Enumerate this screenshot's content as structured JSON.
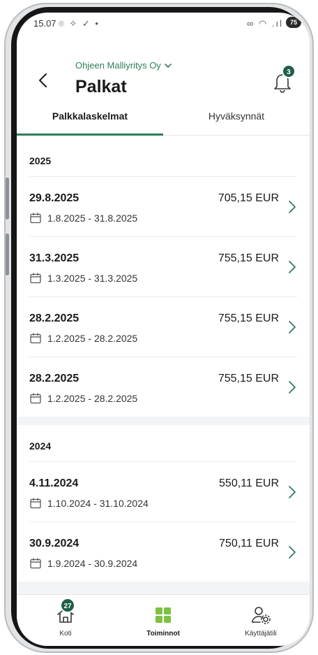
{
  "status_bar": {
    "time": "15.07",
    "icons_left": "⌾ ✧ ✓ •",
    "icons_right": "∞ ◠ .ıl",
    "battery": "75"
  },
  "header": {
    "company": "Ohjeen Malliyritys Oy",
    "title": "Palkat",
    "notification_count": "3"
  },
  "tabs": [
    {
      "label": "Palkkalaskelmat",
      "active": true
    },
    {
      "label": "Hyväksynnät",
      "active": false
    }
  ],
  "years": [
    {
      "year": "2025",
      "items": [
        {
          "date": "29.8.2025",
          "amount": "705,15 EUR",
          "period": "1.8.2025 - 31.8.2025"
        },
        {
          "date": "31.3.2025",
          "amount": "755,15 EUR",
          "period": "1.3.2025 - 31.3.2025"
        },
        {
          "date": "28.2.2025",
          "amount": "755,15 EUR",
          "period": "1.2.2025 - 28.2.2025"
        },
        {
          "date": "28.2.2025",
          "amount": "755,15 EUR",
          "period": "1.2.2025 - 28.2.2025"
        }
      ]
    },
    {
      "year": "2024",
      "items": [
        {
          "date": "4.11.2024",
          "amount": "550,11 EUR",
          "period": "1.10.2024 - 31.10.2024"
        },
        {
          "date": "30.9.2024",
          "amount": "750,11 EUR",
          "period": "1.9.2024 - 30.9.2024"
        }
      ]
    }
  ],
  "bottom_nav": {
    "home": {
      "label": "Koti",
      "badge": "27",
      "icon": "home-icon"
    },
    "actions": {
      "label": "Toiminnot",
      "icon": "grid-icon"
    },
    "account": {
      "label": "Käyttäjätili",
      "icon": "user-settings-icon"
    }
  },
  "colors": {
    "accent": "#2f7d5a",
    "badge": "#1f5f46",
    "grid_green": "#7cc242"
  }
}
